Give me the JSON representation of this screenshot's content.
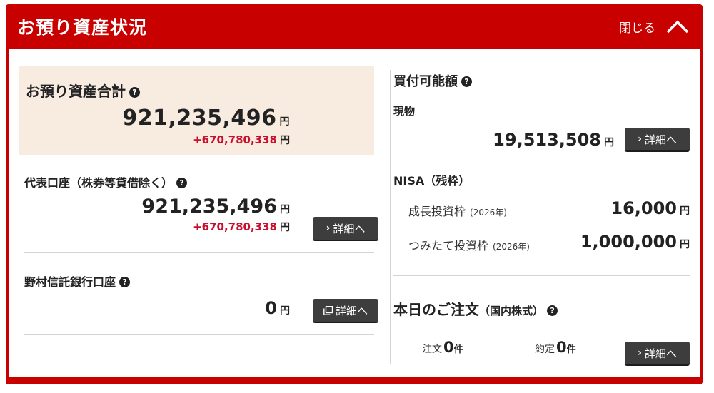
{
  "header": {
    "title": "お預り資産状況",
    "close_label": "閉じる"
  },
  "total": {
    "title": "お預り資産合計",
    "amount": "921,235,496",
    "currency": "円",
    "diff": "+670,780,338"
  },
  "main_account": {
    "title": "代表口座（株券等貸借除く）",
    "amount": "921,235,496",
    "diff": "+670,780,338",
    "detail_label": "詳細へ"
  },
  "trust_bank": {
    "title": "野村信託銀行口座",
    "amount": "0",
    "detail_label": "詳細へ"
  },
  "buying_power": {
    "title": "買付可能額",
    "cash_label": "現物",
    "cash_amount": "19,513,508",
    "detail_label": "詳細へ"
  },
  "nisa": {
    "title": "NISA（残枠）",
    "growth_label": "成長投資枠",
    "growth_year": "(2026年)",
    "growth_amount": "16,000",
    "tsumitate_label": "つみたて投資枠",
    "tsumitate_year": "(2026年)",
    "tsumitate_amount": "1,000,000"
  },
  "orders": {
    "title": "本日のご注文",
    "subtitle": "（国内株式）",
    "order_label": "注文",
    "order_count": "0",
    "executed_label": "約定",
    "executed_count": "0",
    "count_unit": "件",
    "detail_label": "詳細へ"
  },
  "colors": {
    "brand_red": "#c80000",
    "diff_red": "#c8102e",
    "total_bg": "#f8ebe0",
    "button_dark": "#3d3d3d"
  }
}
